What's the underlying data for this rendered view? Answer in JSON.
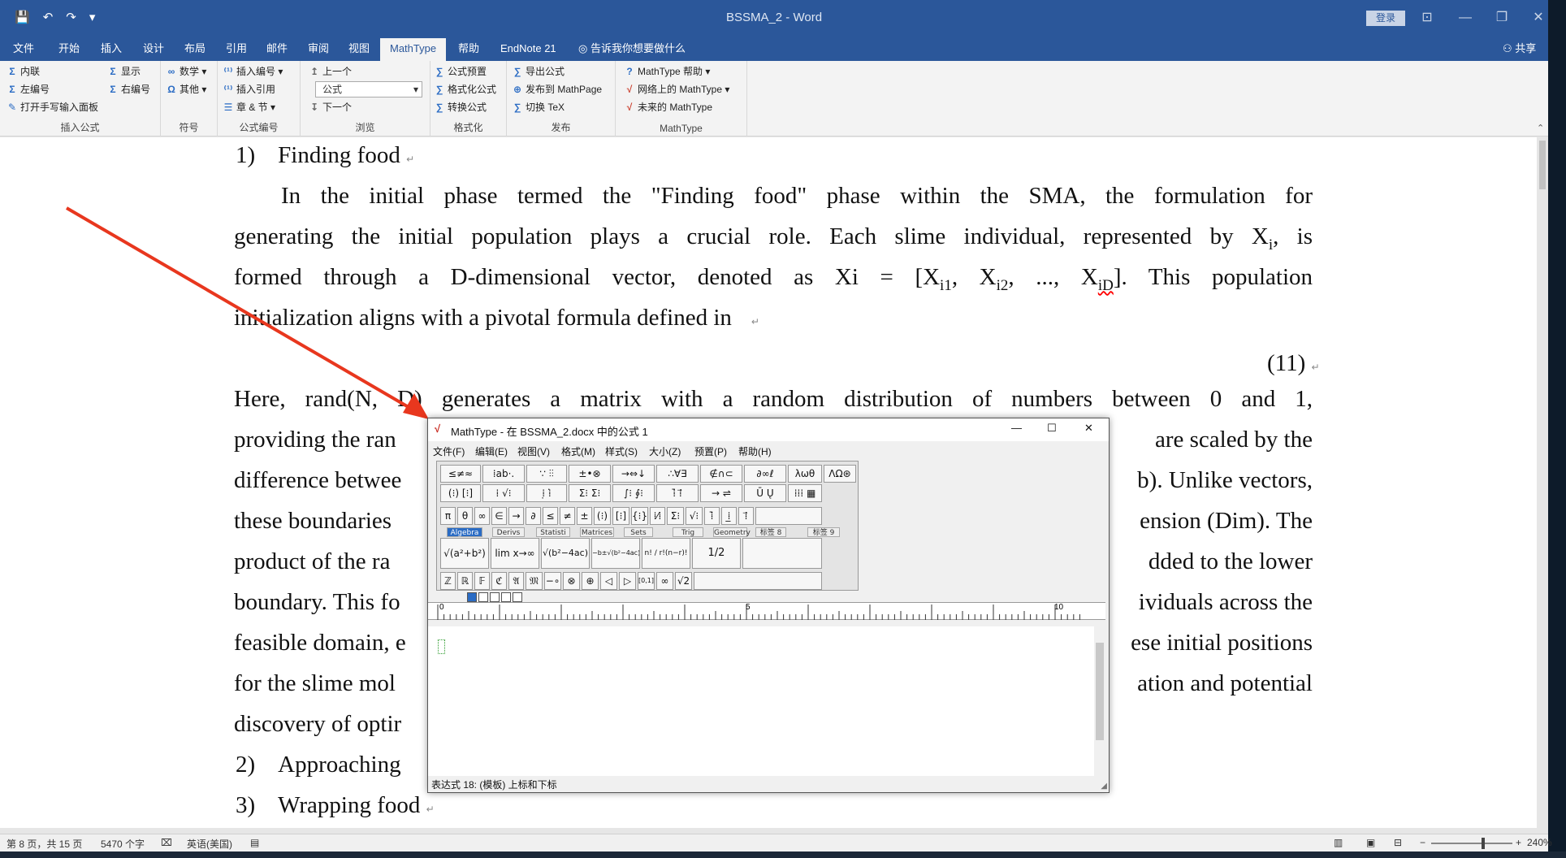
{
  "titlebar": {
    "quick_access": [
      "💾",
      "↶",
      "↷",
      "▾"
    ],
    "doc_title": "BSSMA_2  -  Word",
    "login": "登录",
    "win_controls": [
      "⊡",
      "—",
      "❐",
      "✕"
    ]
  },
  "tabs": [
    "文件",
    "开始",
    "插入",
    "设计",
    "布局",
    "引用",
    "邮件",
    "审阅",
    "视图",
    "MathType",
    "帮助",
    "EndNote 21"
  ],
  "tell_me": "告诉我你想要做什么",
  "share": "共享",
  "ribbon": {
    "g1": {
      "items": [
        "内联",
        "左编号",
        "打开手写输入面板",
        "显示",
        "右编号"
      ],
      "label": "插入公式"
    },
    "g2": {
      "items": [
        "数学",
        "其他"
      ],
      "label": "符号"
    },
    "g3": {
      "items": [
        "插入编号",
        "插入引用",
        "章 & 节"
      ],
      "label": "公式编号"
    },
    "g4": {
      "items": [
        "上一个",
        "下一个"
      ],
      "select_value": "公式",
      "label": "浏览"
    },
    "g5": {
      "items": [
        "公式预置",
        "格式化公式",
        "转换公式"
      ],
      "label": "格式化"
    },
    "g6": {
      "items": [
        "导出公式",
        "发布到 MathPage",
        "切换 TeX"
      ],
      "label": "发布"
    },
    "g7": {
      "items": [
        "MathType 帮助",
        "网络上的 MathType",
        "未来的 MathType"
      ],
      "label": "MathType"
    }
  },
  "document": {
    "h1_num": "1)",
    "h1_text": "Finding food",
    "p1": [
      "In the initial phase termed the \"Finding food\" phase within the SMA, the formulation for",
      "generating the initial population plays a crucial role. Each slime individual, represented by X",
      "formed through a D-dimensional vector, denoted as Xi = [X",
      "initialization aligns with a pivotal formula defined in"
    ],
    "p1_sub_i": "i",
    "p1_line2_end": ", is",
    "p1_line3_parts": [
      "i1",
      ", X",
      "i2",
      ", ..., X",
      "iD",
      "]. This population"
    ],
    "eq_num": "(11)",
    "p2_line1": "Here, rand(N, D) generates a matrix with a random distribution of numbers between 0 and 1,",
    "p2_left": [
      "providing the ran",
      "difference betwee",
      "these boundaries",
      "product of the ra",
      "boundary. This fo",
      "feasible domain, e",
      "for the slime mol",
      "discovery of optir"
    ],
    "p2_right": [
      "are scaled by the",
      "b). Unlike vectors,",
      "ension (Dim). The",
      "dded to the lower",
      "ividuals across the",
      "ese initial positions",
      "ation and potential",
      ""
    ],
    "h2_num": "2)",
    "h2_text": "Approaching",
    "h3_num": "3)",
    "h3_text": "Wrapping food"
  },
  "mathtype": {
    "title": "MathType - 在 BSSMA_2.docx 中的公式 1",
    "menu": [
      "文件(F)",
      "编辑(E)",
      "视图(V)",
      "格式(M)",
      "样式(S)",
      "大小(Z)",
      "预置(P)",
      "帮助(H)"
    ],
    "row1": [
      "≤≠≈",
      "⁞ab·.",
      "∵ ⫶⫶",
      "±•⊗",
      "→⇔↓",
      "∴∀∃",
      "∉∩⊂",
      "∂∞ℓ",
      "λωθ",
      "ΛΩ⊛"
    ],
    "row2": [
      "(⁝) [⁝]",
      "⁞ √⁝",
      "⁞̣ ⁞̇",
      "Σ⁝ Σ⁝",
      "∫⁝ ∮⁝",
      "⁞̄ ⁞⃗",
      "→ ⇌",
      "Ū Ų",
      "⁞⁞⁞ ▦"
    ],
    "row3": [
      "π",
      "θ",
      "∞",
      "∈",
      "→",
      "∂",
      "≤",
      "≠",
      "±",
      "(⁝)",
      "[⁝]",
      "{⁝}",
      "⁞⁄⁞",
      "Σ⁝",
      "√⁝",
      "⁞̄",
      "⁞̲",
      "⁞⃗"
    ],
    "tabs": [
      "Algebra",
      "Derivs",
      "Statisti",
      "Matrices",
      "Sets",
      "Trig",
      "Geometry",
      "标签 8",
      "标签 9"
    ],
    "templates": [
      "√(a²+b²)",
      "lim x→∞",
      "√(b²−4ac)",
      "−b±√(b²−4ac) / 2a",
      "n! / r!(n−r)!",
      "1/2"
    ],
    "row5": [
      "ℤ",
      "ℝ",
      "𝔽",
      "ℭ",
      "𝔄",
      "𝔐",
      "−∘",
      "⊗",
      "⊕",
      "◁",
      "▷",
      "[0,1]",
      "∞",
      "√2"
    ],
    "ruler_marks": [
      "0",
      "5",
      "10"
    ],
    "win_controls": [
      "—",
      "☐",
      "✕"
    ],
    "status": "表达式 18: (模板) 上标和下标"
  },
  "statusbar": {
    "page": "第 8 页，共 15 页",
    "words": "5470 个字",
    "lang": "英语(美国)",
    "zoom": "240%"
  }
}
